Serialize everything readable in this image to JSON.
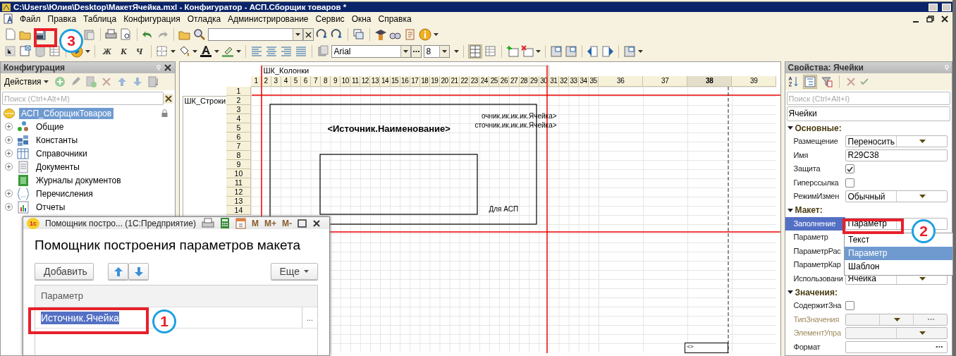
{
  "window": {
    "title": "C:\\Users\\Юлия\\Desktop\\МакетЯчейка.mxl - Конфигуратор - АСП.Сборщик товаров *"
  },
  "menu": [
    "Файл",
    "Правка",
    "Таблица",
    "Конфигурация",
    "Отладка",
    "Администрирование",
    "Сервис",
    "Окна",
    "Справка"
  ],
  "toolbar": {
    "style_buttons": [
      "Ж",
      "К",
      "Ч"
    ],
    "font": "Arial",
    "font_size": "8"
  },
  "config_panel": {
    "title": "Конфигурация",
    "actions": "Действия",
    "search": {
      "placeholder": "Поиск (Ctrl+Alt+M)"
    },
    "tree": [
      {
        "label": "АСП_СборщикТоваров",
        "selected": true,
        "children": [
          {
            "label": "Общие",
            "selected": false,
            "expandable": true
          },
          {
            "label": "Константы",
            "selected": false,
            "expandable": true
          },
          {
            "label": "Справочники",
            "selected": false,
            "expandable": true
          },
          {
            "label": "Документы",
            "selected": false,
            "expandable": true
          },
          {
            "label": "Журналы документов",
            "selected": false,
            "expandable": false
          },
          {
            "label": "Перечисления",
            "selected": false,
            "expandable": true
          },
          {
            "label": "Отчеты",
            "selected": false,
            "expandable": true
          }
        ]
      }
    ]
  },
  "sheet": {
    "column_group": "ШК_Колонки",
    "row_group": "ШК_Строки",
    "columns": [
      {
        "label": "1",
        "selected": false
      },
      {
        "label": "2",
        "selected": false
      },
      {
        "label": "3",
        "selected": false
      },
      {
        "label": "4",
        "selected": false
      },
      {
        "label": "5",
        "selected": false
      },
      {
        "label": "6",
        "selected": false
      },
      {
        "label": "7",
        "selected": false
      },
      {
        "label": "8",
        "selected": false
      },
      {
        "label": "9",
        "selected": false
      },
      {
        "label": "10",
        "selected": false
      },
      {
        "label": "11",
        "selected": false
      },
      {
        "label": "12",
        "selected": false
      },
      {
        "label": "13",
        "selected": false
      },
      {
        "label": "14",
        "selected": false
      },
      {
        "label": "15",
        "selected": false
      },
      {
        "label": "16",
        "selected": false
      },
      {
        "label": "17",
        "selected": false
      },
      {
        "label": "18",
        "selected": false
      },
      {
        "label": "19",
        "selected": false
      },
      {
        "label": "20",
        "selected": false
      },
      {
        "label": "21",
        "selected": false
      },
      {
        "label": "22",
        "selected": false
      },
      {
        "label": "23",
        "selected": false
      },
      {
        "label": "24",
        "selected": false
      },
      {
        "label": "25",
        "selected": false
      },
      {
        "label": "26",
        "selected": false
      },
      {
        "label": "27",
        "selected": false
      },
      {
        "label": "28",
        "selected": false
      },
      {
        "label": "29",
        "selected": false
      },
      {
        "label": "30",
        "selected": false
      },
      {
        "label": "31",
        "selected": false
      },
      {
        "label": "32",
        "selected": false
      },
      {
        "label": "33",
        "selected": false
      },
      {
        "label": "34",
        "selected": false
      },
      {
        "label": "35",
        "selected": false
      },
      {
        "label": "36",
        "selected": false
      },
      {
        "label": "37",
        "selected": false
      },
      {
        "label": "38",
        "selected": true
      },
      {
        "label": "39",
        "selected": false
      }
    ],
    "rows": [
      "1",
      "2",
      "3",
      "4",
      "5",
      "6",
      "7",
      "8",
      "9",
      "10",
      "11",
      "12",
      "13",
      "14"
    ],
    "texts": [
      {
        "text": "<Источник.Наименование>",
        "kind": "bold"
      },
      {
        "text": "очник.ик.ик.ик.Ячейка>",
        "kind": "plain"
      },
      {
        "text": "сточник.ик.ик.ик.Ячейка>",
        "kind": "plain"
      },
      {
        "text": "Для АСП",
        "kind": "plain"
      }
    ],
    "cell_marker": "<>"
  },
  "properties": {
    "title": "Свойства: Ячейки",
    "search": {
      "placeholder": "Поиск (Ctrl+Alt+I)"
    },
    "object": "Ячейки",
    "groups": [
      {
        "title": "Основные:",
        "items": [
          {
            "name": "Размещение",
            "kind": "select",
            "value": "Переносить",
            "selected": false,
            "disabled": false
          },
          {
            "name": "Имя",
            "kind": "text",
            "value": "R29C38",
            "selected": false,
            "disabled": false
          },
          {
            "name": "Защита",
            "kind": "checkbox",
            "checked": true,
            "selected": false,
            "disabled": false
          },
          {
            "name": "Гиперссылка",
            "kind": "checkbox",
            "checked": false,
            "selected": false,
            "disabled": false
          },
          {
            "name": "РежимИзмен",
            "kind": "select",
            "value": "Обычный",
            "selected": false,
            "disabled": false
          }
        ]
      },
      {
        "title": "Макет:",
        "items": [
          {
            "name": "Заполнение",
            "kind": "select",
            "value": "Параметр",
            "selected": true,
            "disabled": false
          },
          {
            "name": "Параметр",
            "kind": "blank",
            "selected": false,
            "disabled": false
          },
          {
            "name": "ПараметрРас",
            "kind": "blank",
            "selected": false,
            "disabled": false
          },
          {
            "name": "ПараметрКар",
            "kind": "blank",
            "selected": false,
            "disabled": false
          },
          {
            "name": "Использовани",
            "kind": "select",
            "value": "Ячейка",
            "selected": false,
            "disabled": false
          }
        ]
      },
      {
        "title": "Значения:",
        "items": [
          {
            "name": "СодержитЗна",
            "kind": "checkbox",
            "checked": false,
            "selected": false,
            "disabled": false
          },
          {
            "name": "ТипЗначения",
            "kind": "select_choice",
            "selected": false,
            "disabled": true
          },
          {
            "name": "ЭлементУпра",
            "kind": "select",
            "selected": false,
            "disabled": true
          },
          {
            "name": "Формат",
            "kind": "choice",
            "selected": false,
            "disabled": false
          }
        ]
      }
    ],
    "dropdown": [
      {
        "label": "Текст",
        "selected": false
      },
      {
        "label": "Параметр",
        "selected": true
      },
      {
        "label": "Шаблон",
        "selected": false
      }
    ]
  },
  "dialog": {
    "logo": "1с",
    "title": "Помощник постро... (1С:Предприятие)",
    "memory_buttons": [
      "M",
      "M+",
      "M-"
    ],
    "heading": "Помощник построения параметров макета",
    "add": "Добавить",
    "more": "Еще",
    "column": "Параметр",
    "rows": [
      {
        "value": "Источник.Ячейка",
        "selected": true
      }
    ],
    "choose": "..."
  },
  "annotations": [
    "3",
    "1",
    "2"
  ]
}
